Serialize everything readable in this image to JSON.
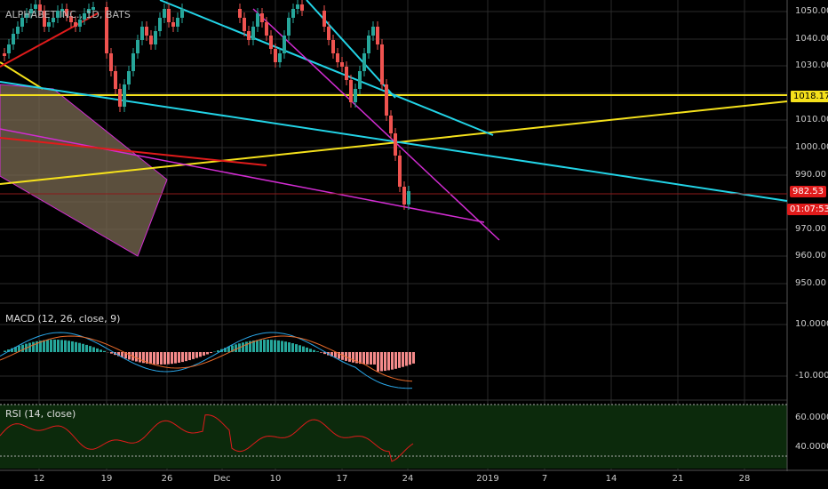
{
  "symbol_title": "ALPHABET INC., 1D, BATS",
  "macd_label": "MACD (12, 26, close, 9)",
  "rsi_label": "RSI (14, close)",
  "price_axis": [
    "1050.00",
    "1040.00",
    "1030.00",
    "1018.17",
    "1010.00",
    "1000.00",
    "990.00",
    "982.53",
    "970.00",
    "960.00",
    "950.00"
  ],
  "macd_axis": [
    "10.0000",
    "-10.0000"
  ],
  "rsi_axis": [
    "60.0000",
    "40.0000"
  ],
  "date_axis": [
    "12",
    "19",
    "26",
    "Dec",
    "10",
    "17",
    "24",
    "2019",
    "7",
    "14",
    "21",
    "28"
  ],
  "tags": {
    "hline_price": "1018.17",
    "last_price": "982.53",
    "countdown": "01:07:53"
  },
  "colors": {
    "background": "#000000",
    "grid": "#2a2a2a",
    "up": "#26a69a",
    "down": "#ef5350",
    "cyan": "#22d3e6",
    "yellow": "#f5e11b",
    "magenta": "#d12cd1",
    "red": "#e01b1b",
    "channel": "#7a6a52",
    "rsi_bg": "#0c2a0c"
  },
  "chart_data": {
    "type": "candlestick",
    "price_scale": {
      "min": 945,
      "max": 1055
    },
    "hline_level": 1018.17,
    "last_price": 982.53,
    "date_ticks": [
      "12",
      "19",
      "26",
      "Dec",
      "10",
      "17",
      "24",
      "2019",
      "7",
      "14",
      "21",
      "28"
    ]
  }
}
